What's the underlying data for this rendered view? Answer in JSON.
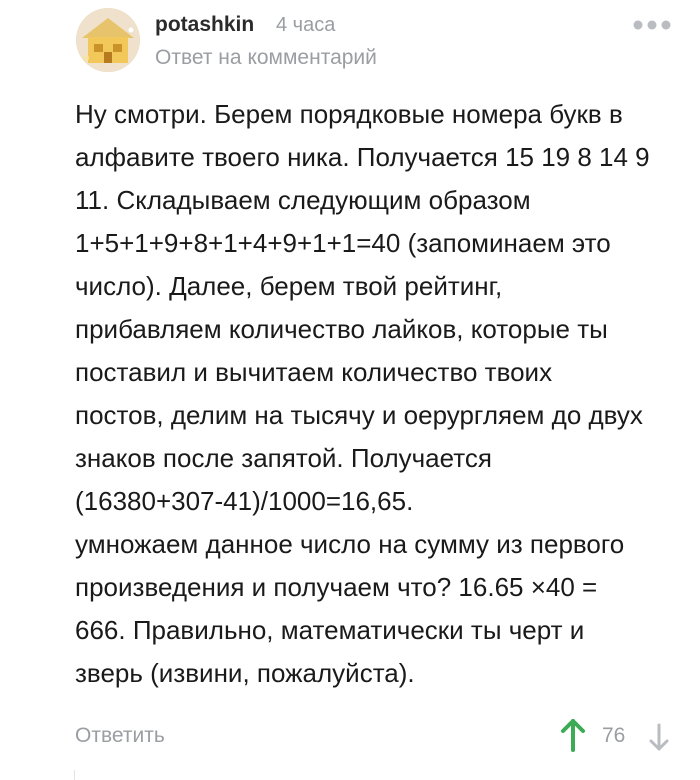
{
  "comment": {
    "author": "potashkin",
    "time": "4 часа",
    "reply_prefix": "Ответ на",
    "reply_link": "комментарий",
    "body_lines": [
      "Ну смотри. Берем порядковые номера букв в",
      "алфавите твоего ника. Получается 15 19 8 14 9",
      "11. Складываем следующим образом",
      "1+5+1+9+8+1+4+9+1+1=40 (запоминаем это",
      "число). Далее, берем твой рейтинг,",
      "прибавляем количество лайков, которые ты",
      "поставил и вычитаем количество твоих",
      "постов, делим на тысячу и оерургляем до двух",
      "знаков после запятой. Получается",
      "(16380+307-41)/1000=16,65.",
      "умножаем данное число на сумму из первого",
      "произведения и получаем что? 16.65 ×40 =",
      "666. Правильно, математически ты черт и",
      "зверь (извини, пожалуйста)."
    ],
    "reply_button": "Ответить",
    "rating": "76"
  },
  "icons": {
    "more": "more-dots-icon",
    "upvote": "arrow-up-icon",
    "downvote": "arrow-down-icon",
    "avatar": "avatar-image"
  },
  "colors": {
    "upvote": "#3daa55",
    "muted": "#9a9ea3",
    "text": "#1a1a1a"
  }
}
